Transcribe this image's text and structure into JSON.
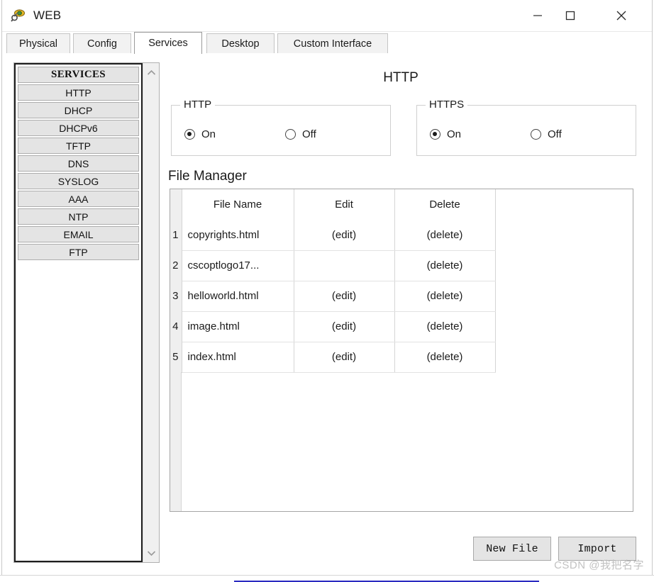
{
  "window": {
    "title": "WEB",
    "icon": "packet-tracer-device-icon",
    "controls": {
      "minimize": "minimize-icon",
      "maximize": "maximize-icon",
      "close": "close-icon"
    }
  },
  "tabs": [
    {
      "label": "Physical",
      "active": false
    },
    {
      "label": "Config",
      "active": false
    },
    {
      "label": "Services",
      "active": true
    },
    {
      "label": "Desktop",
      "active": false
    },
    {
      "label": "Custom Interface",
      "active": false
    }
  ],
  "sidebar": {
    "header": "SERVICES",
    "items": [
      {
        "label": "HTTP"
      },
      {
        "label": "DHCP"
      },
      {
        "label": "DHCPv6"
      },
      {
        "label": "TFTP"
      },
      {
        "label": "DNS"
      },
      {
        "label": "SYSLOG"
      },
      {
        "label": "AAA"
      },
      {
        "label": "NTP"
      },
      {
        "label": "EMAIL"
      },
      {
        "label": "FTP"
      }
    ],
    "scrollbar": {
      "up_icon": "chevron-up-icon",
      "down_icon": "chevron-down-icon"
    }
  },
  "main": {
    "page_title": "HTTP",
    "http_group": {
      "legend": "HTTP",
      "on_label": "On",
      "off_label": "Off",
      "selected": "On"
    },
    "https_group": {
      "legend": "HTTPS",
      "on_label": "On",
      "off_label": "Off",
      "selected": "On"
    },
    "file_manager": {
      "title": "File Manager",
      "columns": [
        "",
        "File Name",
        "Edit",
        "Delete"
      ],
      "rows": [
        {
          "num": "1",
          "name": "copyrights.html",
          "edit": "(edit)",
          "delete": "(delete)"
        },
        {
          "num": "2",
          "name": "cscoptlogo17...",
          "edit": "",
          "delete": "(delete)"
        },
        {
          "num": "3",
          "name": "helloworld.html",
          "edit": "(edit)",
          "delete": "(delete)"
        },
        {
          "num": "4",
          "name": "image.html",
          "edit": "(edit)",
          "delete": "(delete)"
        },
        {
          "num": "5",
          "name": "index.html",
          "edit": "(edit)",
          "delete": "(delete)"
        }
      ]
    },
    "buttons": {
      "new_file": "New File",
      "import": "Import"
    }
  },
  "watermark": "CSDN @我把名字",
  "colors": {
    "window_bg": "#ffffff",
    "button_face": "#e4e4e4",
    "button_border": "#a8a8a8",
    "list_border": "#1e1e1e",
    "groupbox_border": "#cfcfcf",
    "table_border": "#a6a6a6",
    "gutter_bg": "#efefef",
    "text": "#1b1b1b",
    "watermark": "#c2c2c2"
  }
}
